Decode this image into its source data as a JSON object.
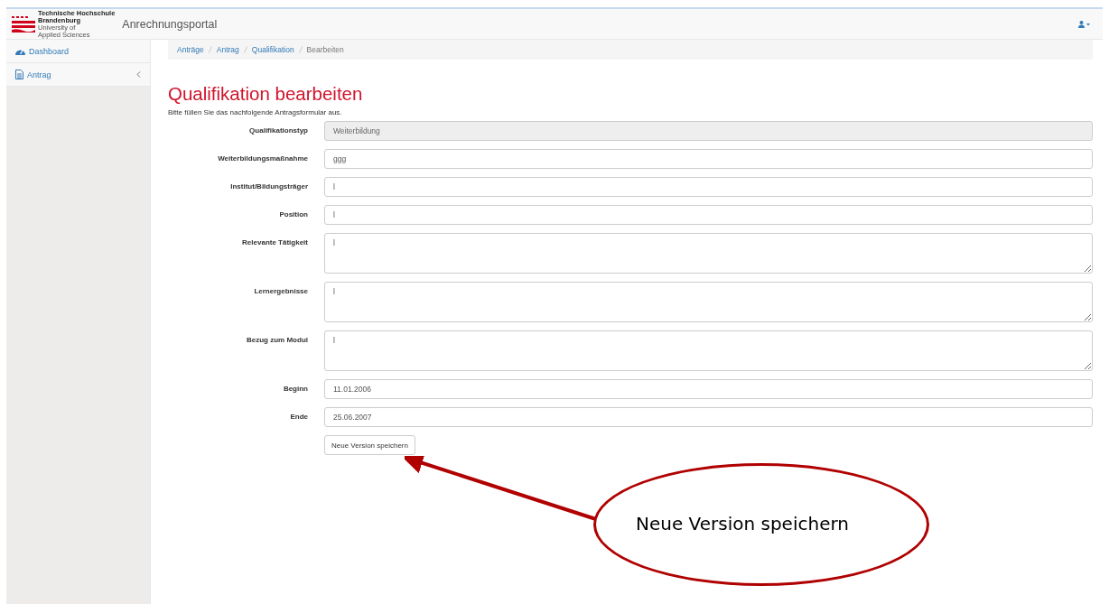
{
  "navbar": {
    "logo_text": [
      "Technische Hochschule",
      "Brandenburg",
      "University of",
      "Applied Sciences"
    ],
    "brand": "Anrechnungsportal"
  },
  "sidebar": {
    "items": [
      {
        "label": "Dashboard",
        "kind": "dashboard",
        "selected": false,
        "expandable": false
      },
      {
        "label": "Antrag",
        "kind": "document",
        "selected": false,
        "expandable": true
      }
    ]
  },
  "breadcrumb": [
    {
      "label": "Anträge",
      "link": true
    },
    {
      "label": "Antrag",
      "link": true
    },
    {
      "label": "Qualifikation",
      "link": true
    },
    {
      "label": "Bearbeiten",
      "link": false
    }
  ],
  "page": {
    "title": "Qualifikation bearbeiten",
    "intro": "Bitte füllen Sie das nachfolgende Antragsformular aus."
  },
  "form": {
    "fields": [
      {
        "label": "Qualifikationstyp",
        "value": "Weiterbildung",
        "kind": "input",
        "disabled": true
      },
      {
        "label": "Weiterbildungsmaßnahme",
        "value": "ggg",
        "kind": "input",
        "disabled": false
      },
      {
        "label": "Institut/Bildungsträger",
        "value": "l",
        "kind": "input",
        "disabled": false
      },
      {
        "label": "Position",
        "value": "l",
        "kind": "input",
        "disabled": false
      },
      {
        "label": "Relevante Tätigkeit",
        "value": "l",
        "kind": "textarea",
        "disabled": false
      },
      {
        "label": "Lernergebnisse",
        "value": "l",
        "kind": "textarea",
        "disabled": false
      },
      {
        "label": "Bezug zum Modul",
        "value": "l",
        "kind": "textarea",
        "disabled": false
      },
      {
        "label": "Beginn",
        "value": "11.01.2006",
        "kind": "input",
        "disabled": false
      },
      {
        "label": "Ende",
        "value": "25.06.2007",
        "kind": "input",
        "disabled": false
      }
    ],
    "submit": "Neue Version speichern"
  },
  "callout": {
    "text": "Neue Version speichern"
  }
}
